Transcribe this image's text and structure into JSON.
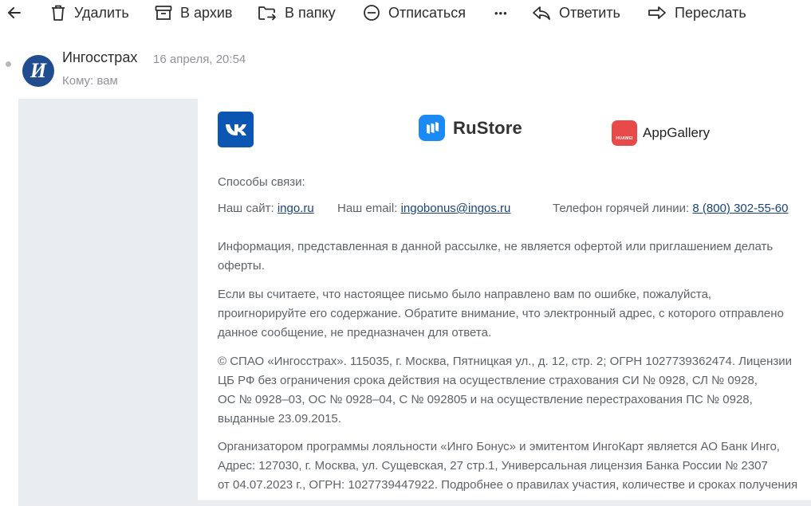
{
  "toolbar": {
    "back_label": "←",
    "delete_label": "Удалить",
    "archive_label": "В архив",
    "folder_label": "В папку",
    "unsubscribe_label": "Отписаться",
    "more_label": "•••",
    "reply_label": "Ответить",
    "forward_label": "Переслать"
  },
  "message": {
    "avatar_letter": "И",
    "sender": "Ингосстрах",
    "date": "16 апреля, 20:54",
    "to": "Кому: вам"
  },
  "body": {
    "logos": {
      "rustore": "RuStore",
      "appgallery": "AppGallery",
      "huawei": "HUAWEI"
    },
    "contacts_heading": "Способы связи:",
    "site_label": "Наш сайт:",
    "site_link": "ingo.ru",
    "email_label": "Наш email:",
    "email_link": "ingobonus@ingos.ru",
    "phone_label": "Телефон горячей линии:",
    "phone_link": "8 (800) 302-55-60",
    "para1_l1": "Информация, представленная в данной рассылке, не является офертой или приглашением делать",
    "para1_l2": "оферты.",
    "para2_l1": "Если вы считаете, что настоящее письмо было направлено вам по ошибке, пожалуйста,",
    "para2_l2": "проигнорируйте его содержание. Обратите внимание, что электронный адрес, с которого отправлено",
    "para2_l3": "данное сообщение, не предназначен для ответа.",
    "para3_l1": "© СПАО «Ингосстрах». 115035, г. Москва, Пятницкая ул., д. 12, стр. 2; ОГРН 1027739362474. Лицензии",
    "para3_l2": "ЦБ РФ без ограничения срока действия на осуществление страхования СИ № 0928, СЛ № 0928,",
    "para3_l3": "ОС № 0928–03, ОС № 0928–04, С № 092805 и на осуществление перестрахования ПС № 0928,",
    "para3_l4": "выданные 23.09.2015.",
    "para4_l1": "Организатором программы лояльности «Инго Бонус» и эмитентом ИнгоКарт является АО Банк Инго,",
    "para4_l2": "Адрес: 127030, г. Москва, ул. Сущевская, 27 стр.1, Универсальная лицензия Банка России № 2307",
    "para4_l3": "от 04.07.2023 г., ОГРН: 1027739447922. Подробнее о правилах участия, количестве и сроках получения"
  }
}
